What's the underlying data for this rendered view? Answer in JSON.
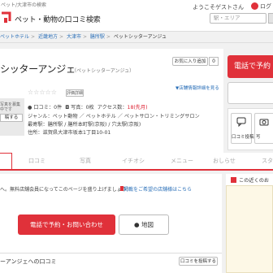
{
  "header": {
    "site_sub": "ペット/大津市の検索",
    "site_title": "ペット・動物の口コミ検索",
    "welcome": "ようこそゲストさん",
    "login": "ログ",
    "area_placeholder": "駅・エリア"
  },
  "breadcrumb": [
    {
      "label": "ペットホテル"
    },
    {
      "label": "近畿地方"
    },
    {
      "label": "大津市"
    },
    {
      "label": "膳所駅"
    },
    {
      "label": "ペットシッターアンジュ"
    }
  ],
  "shop": {
    "name": "シッターアンジェ",
    "name_kana": "（ペットシッターアンジュ）",
    "fav_label": "お気に入り追加",
    "fav_count": "0",
    "stars": "☆☆☆☆☆",
    "rate_detail": "評価詳細",
    "shop_info_link": "▼店舗情報詳細を見る",
    "photo_text": "写真を募集中です",
    "photo_btn": "稿する",
    "reviews": "口コミ：0件",
    "photos": "写真：0枚",
    "access_label": "アクセス数：",
    "access_count": "18(先月)",
    "genre": "ジャンル：ペット動物 ／ ペットホテル ／ ペットサロン・トリミングサロン",
    "station": "最寄駅：膳所駅 / 膳所本町駅(京阪) / 穴太駅(京阪)",
    "address": "住所：滋賀県大津市坂本1丁目10-01"
  },
  "side_actions": {
    "call": "電話で予約",
    "review": "口コミ投稿",
    "other": "写"
  },
  "tabs": [
    {
      "label": "口コミ"
    },
    {
      "label": "写真"
    },
    {
      "label": "イチオシ"
    },
    {
      "label": "メニュー"
    },
    {
      "label": "おしらせ"
    },
    {
      "label": "スタ"
    }
  ],
  "content": {
    "notice": "へ。無料店舗会員になってこのページを盛り上げましょう！",
    "notice_link": "掲載をご希望の店舗様はこちら",
    "cta_call": "電話で予約・お問い合わせ",
    "cta_map": "地図",
    "section_title": "ーアンジェへの口コミ",
    "section_btn": "口コミを投稿する"
  },
  "side_panel": {
    "title": "この近くのお"
  },
  "colors": {
    "accent": "#e0313a",
    "link": "#2a6fb8"
  }
}
